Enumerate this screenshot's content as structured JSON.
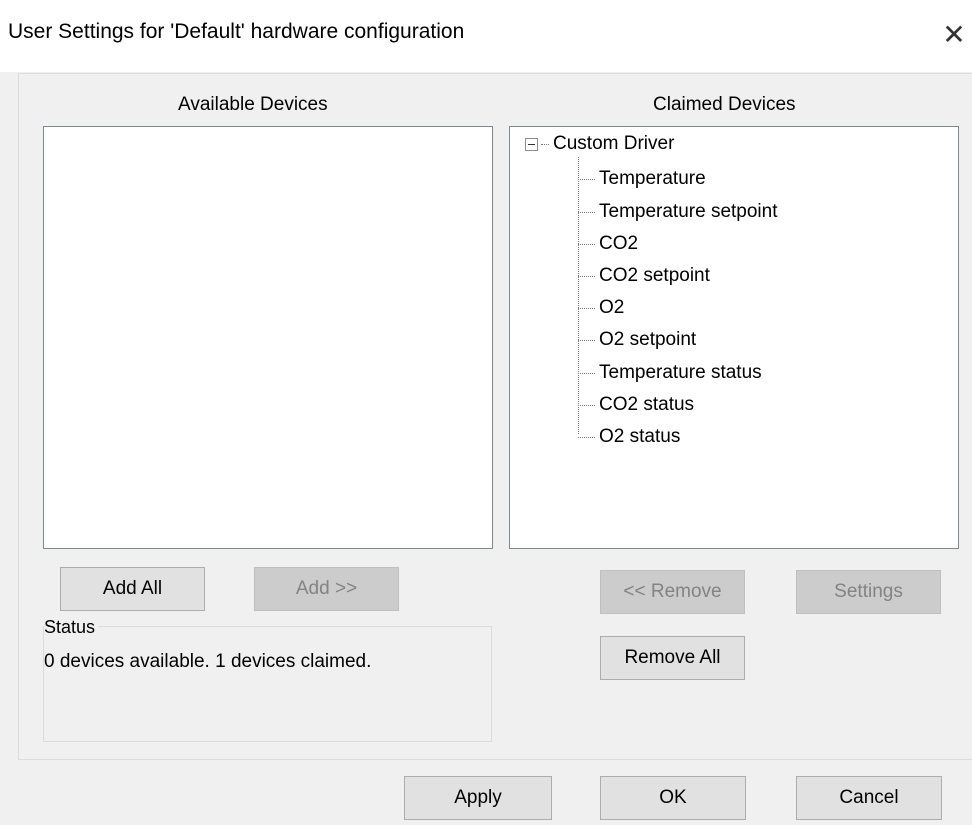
{
  "window": {
    "title": "User Settings for 'Default' hardware configuration",
    "close_glyph": "✕"
  },
  "available": {
    "heading": "Available Devices",
    "items": []
  },
  "claimed": {
    "heading": "Claimed Devices",
    "root_label": "Custom Driver",
    "children": [
      "Temperature",
      "Temperature setpoint",
      "CO2",
      "CO2 setpoint",
      "O2",
      "O2 setpoint",
      "Temperature status",
      "CO2 status",
      "O2 status"
    ]
  },
  "buttons": {
    "add_all": "Add All",
    "add": "Add >>",
    "remove": "<< Remove",
    "settings": "Settings",
    "remove_all": "Remove All",
    "apply": "Apply",
    "ok": "OK",
    "cancel": "Cancel"
  },
  "status": {
    "legend": "Status",
    "text": "0 devices available. 1 devices claimed."
  },
  "icons": {
    "close": "close-icon",
    "expander": "collapse-minus-icon"
  }
}
